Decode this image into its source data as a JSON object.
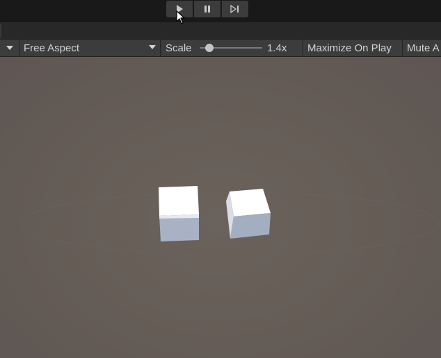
{
  "play_controls": {
    "play_icon": "play-icon",
    "pause_icon": "pause-icon",
    "step_icon": "step-icon"
  },
  "game_toolbar": {
    "display_dropdown_icon": "chevron-down-icon",
    "aspect_label": "Free Aspect",
    "scale_label": "Scale",
    "scale_value": "1.4x",
    "scale_slider_fraction": 0.15,
    "maximize_label": "Maximize On Play",
    "mute_label": "Mute A"
  },
  "viewport": {
    "background_color": "#665d57",
    "cube_top_color": "#ffffff",
    "cube_side_color": "#b3bccb",
    "cube_front_color": "#9ba6b8",
    "cubes": [
      "cube-left",
      "cube-right"
    ]
  },
  "cursor": {
    "icon": "mouse-pointer-icon"
  }
}
